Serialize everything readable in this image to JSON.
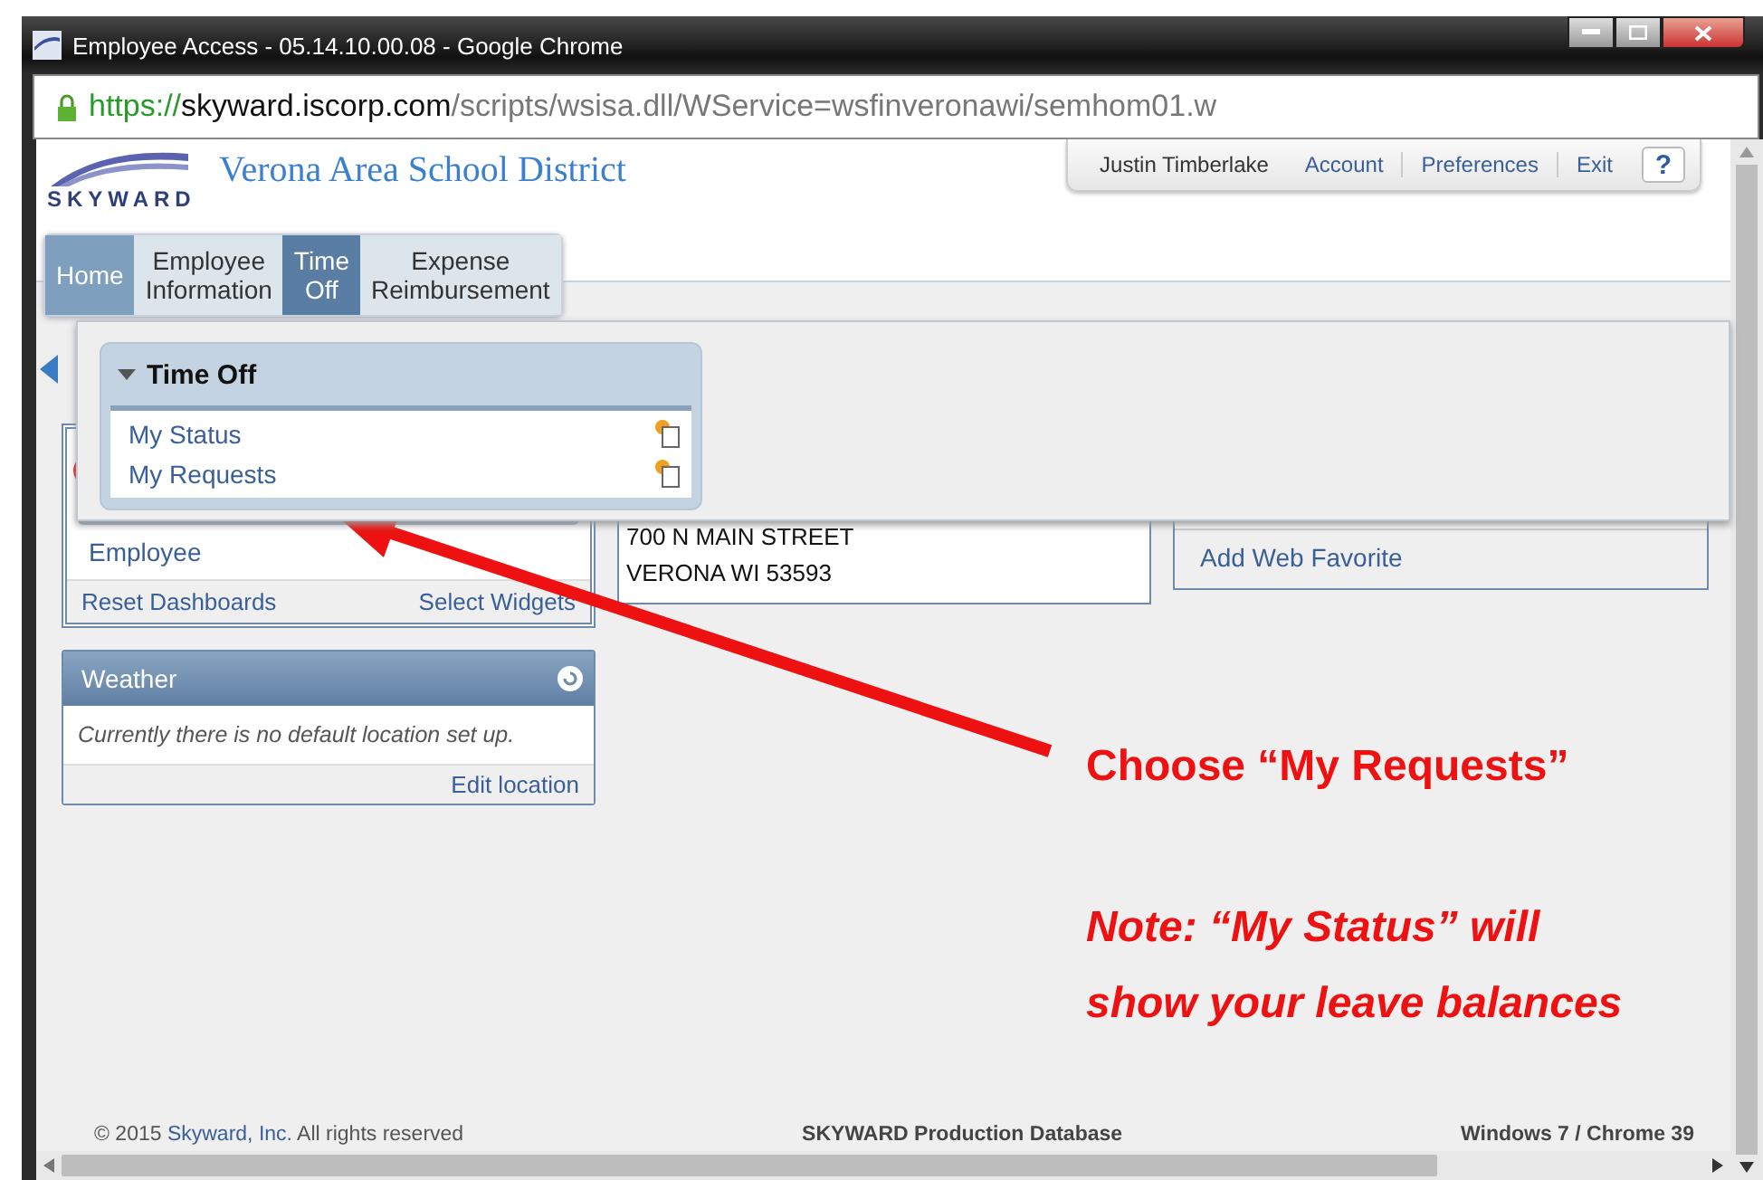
{
  "window": {
    "title": "Employee Access - 05.14.10.00.08 - Google Chrome"
  },
  "address_bar": {
    "scheme": "https://",
    "host": "skyward.iscorp.com",
    "path": "/scripts/wsisa.dll/WService=wsfinveronawi/semhom01.w"
  },
  "header": {
    "logo": "SKYWARD",
    "district": "Verona Area School District",
    "user": "Justin Timberlake",
    "links": [
      "Account",
      "Preferences",
      "Exit"
    ],
    "help": "?"
  },
  "nav_tabs": [
    {
      "lines": [
        "Home"
      ],
      "current": true,
      "selected": false
    },
    {
      "lines": [
        "Employee",
        "Information"
      ],
      "current": false,
      "selected": false
    },
    {
      "lines": [
        "Time",
        "Off"
      ],
      "current": false,
      "selected": true
    },
    {
      "lines": [
        "Expense",
        "Reimbursement"
      ],
      "current": false,
      "selected": false
    }
  ],
  "dropdown": {
    "title": "Time Off",
    "expanded": true,
    "items": [
      {
        "label": "My Status"
      },
      {
        "label": "My Requests"
      }
    ]
  },
  "dashboard": {
    "items": [
      "Employee"
    ],
    "footer_links": [
      "Reset Dashboards",
      "Select Widgets"
    ],
    "address": [
      "700 N MAIN STREET",
      "VERONA WI 53593"
    ],
    "favorite_link": "Add Web Favorite"
  },
  "weather": {
    "title": "Weather",
    "message": "Currently there is no default location set up.",
    "link": "Edit location"
  },
  "footer": {
    "copyright_prefix": "© 2015 ",
    "company": "Skyward, Inc.",
    "copyright_suffix": " All rights reserved",
    "database": "SKYWARD Production Database",
    "platform": "Windows 7 / Chrome 39"
  },
  "annotation": {
    "callout": "Choose “My Requests”",
    "note_lines": [
      "Note: “My Status” will",
      "show your leave balances"
    ]
  }
}
